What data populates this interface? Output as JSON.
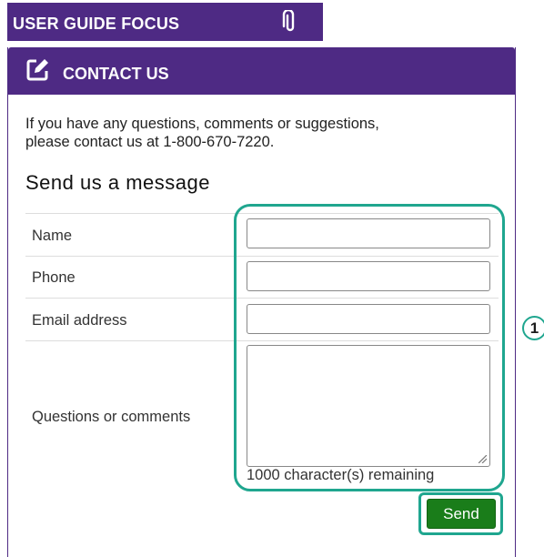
{
  "guide_tab": {
    "title": "USER GUIDE FOCUS",
    "icon": "paperclip-icon"
  },
  "panel": {
    "header_title": "CONTACT US",
    "header_icon": "edit-icon",
    "intro_line1": "If you have any questions, comments or suggestions,",
    "intro_line2": "please contact us at 1-800-670-7220.",
    "heading": "Send us a message"
  },
  "form": {
    "name_label": "Name",
    "name_value": "",
    "phone_label": "Phone",
    "phone_value": "",
    "email_label": "Email address",
    "email_value": "",
    "comments_label": "Questions or comments",
    "comments_value": "",
    "remaining_text": "1000 character(s) remaining",
    "send_label": "Send"
  },
  "annotation": {
    "callout_number": "1",
    "color": "#1fa68f"
  },
  "colors": {
    "brand_purple": "#4e2a84",
    "send_green": "#1a7d1a"
  }
}
